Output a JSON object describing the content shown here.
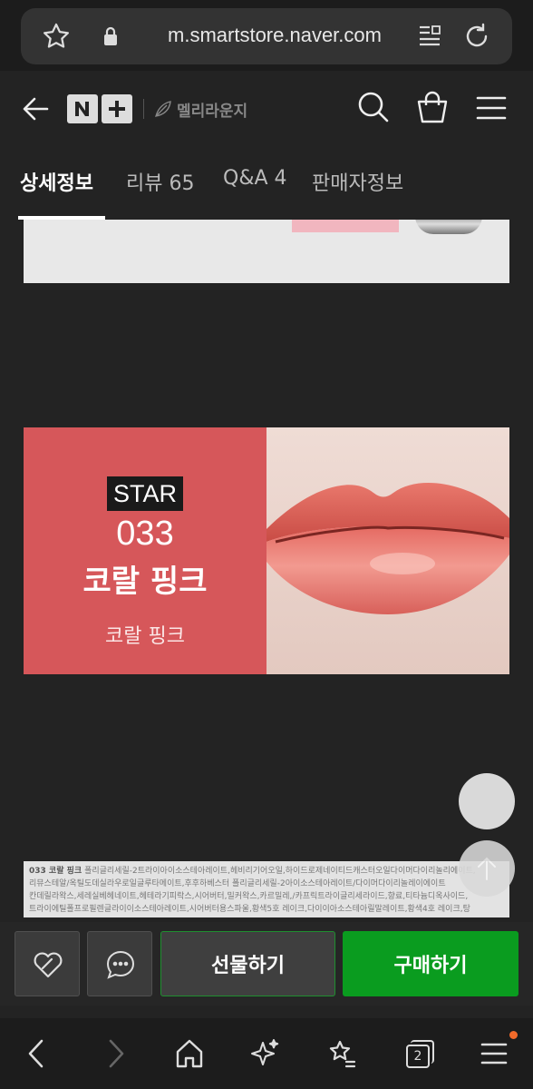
{
  "browser": {
    "url": "m.smartstore.naver.com",
    "tab_count": "2"
  },
  "header": {
    "store_name": "멜리라운지",
    "logo_label": "N+"
  },
  "tabs": [
    {
      "label": "상세정보",
      "active": true
    },
    {
      "label": "리뷰 65",
      "active": false
    },
    {
      "label": "Q&A 4",
      "active": false
    },
    {
      "label": "판매자정보",
      "active": false
    }
  ],
  "banner": {
    "badge": "STAR",
    "shade_code": "033",
    "shade_name": "코랄 핑크",
    "shade_sub": "코랄 핑크"
  },
  "ingredients": {
    "heading": "033 코랄 핑크",
    "line1": "폴리글리세릴-2트라이아이소스테아레이트,헤비리기어오일,하이드로제네이티드캐스터오일다이머다이리놀리에이트,",
    "line2": "리뮤스테알/옥틸도데실라우로일글루타메이트,후후하베스터 폴리글리세릴-2아이소스테아레이트/다이머다이리놀레이에이트",
    "line3": "칸데릴라왁스,세레실베헤네이트,헤테라기피락스,시어버터,밀커왁스,카르밀레,/카프릭트라이글리세라이드,향료,티타늄디옥사이드,",
    "line4": "트라이에틸폴프로필렌글라이이소스테아레이트,시어버터용스파울,황색5호 레이크,다이이아소스테아릴말레이트,황색4호 레이크,탕"
  },
  "actions": {
    "gift_label": "선물하기",
    "buy_label": "구매하기"
  },
  "colors": {
    "buy_green": "#0a9c1f",
    "banner_coral": "#d6575a",
    "notification": "#f26a2a"
  }
}
